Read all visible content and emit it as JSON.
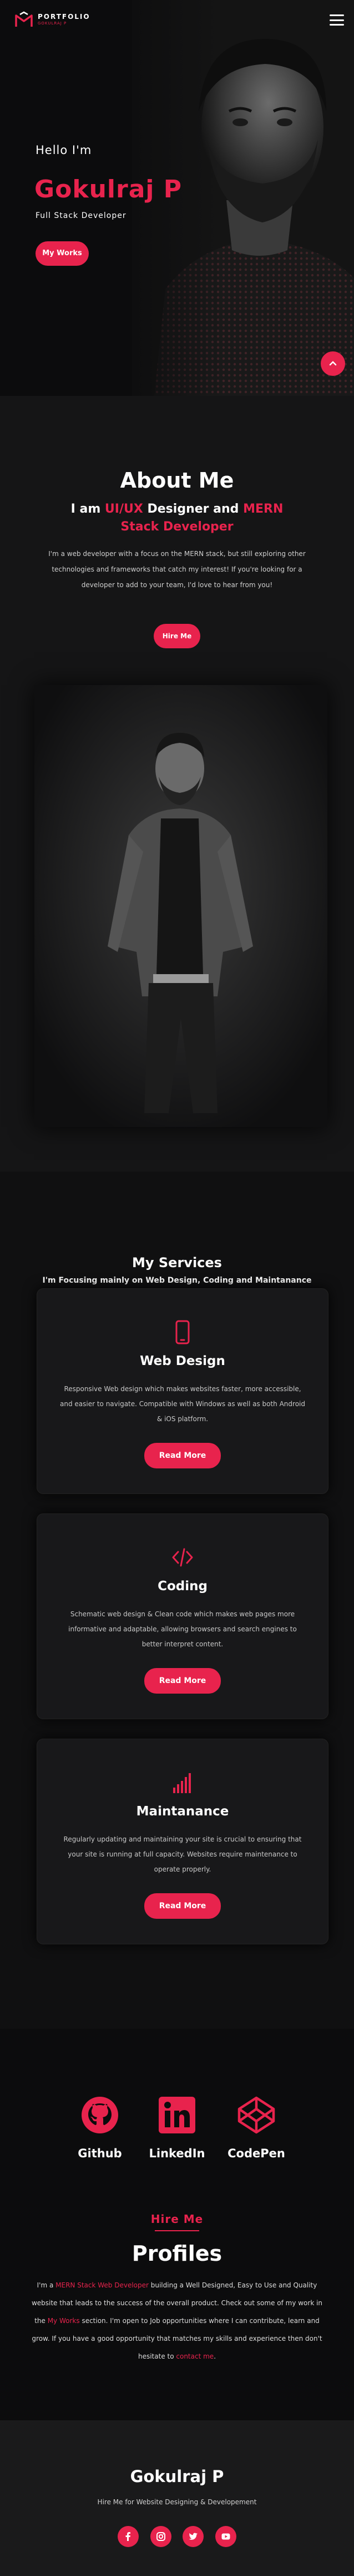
{
  "nav": {
    "logo_title": "PORTFOLIO",
    "logo_subtitle": "GOKULRAJ P"
  },
  "hero": {
    "hello": "Hello   I'm",
    "name": "Gokulraj P",
    "role": "Full   Stack   Developer",
    "button": "My Works"
  },
  "about": {
    "heading": "About Me",
    "sub_prefix": "I am ",
    "sub_accent1": "UI/UX",
    "sub_mid": " Designer and ",
    "sub_accent2": "MERN Stack Developer",
    "text": "I'm a web developer with a focus on the MERN stack, but still exploring other technologies and frameworks that catch my interest! If you're looking for a developer to add to your team, I'd love to hear from you!",
    "button": "Hire Me"
  },
  "services": {
    "heading": "My Services",
    "subheading": "I'm Focusing mainly on Web Design, Coding and Maintanance",
    "cards": [
      {
        "icon": "mobile-icon",
        "title": "Web Design",
        "text": "Responsive Web design which makes websites faster, more accessible, and easier to navigate. Compatible with Windows as well as both Android & iOS platform.",
        "button": "Read More"
      },
      {
        "icon": "code-icon",
        "title": "Coding",
        "text": "Schematic web design & Clean code which makes web pages more informative and adaptable, allowing browsers and search engines to better interpret content.",
        "button": "Read More"
      },
      {
        "icon": "signal-bars-icon",
        "title": "Maintanance",
        "text": "Regularly updating and maintaining your site is crucial to ensuring that your site is running at full capacity. Websites require maintenance to operate properly.",
        "button": "Read More"
      }
    ]
  },
  "profiles": {
    "items": [
      {
        "label": "Github",
        "icon": "github-icon"
      },
      {
        "label": "LinkedIn",
        "icon": "linkedin-icon"
      },
      {
        "label": "CodePen",
        "icon": "codepen-icon"
      }
    ],
    "tag": "Hire Me",
    "heading": "Profiles",
    "text_1": "I'm a ",
    "text_link1": "MERN Stack Web Developer",
    "text_2": " building a Well Designed, Easy to Use and Quality website that leads to the success of the overall product. Check out some of my work in the ",
    "text_link2": "My Works",
    "text_3": " section. I'm open to Job opportunities where I can contribute, learn and grow. If you have a good opportunity that matches my skills and experience then don't hesitate to ",
    "text_link3": "contact me",
    "text_4": "."
  },
  "footer": {
    "name": "Gokulraj P",
    "subtitle": "Hire Me for Website Designing & Developement",
    "socials": [
      "facebook-icon",
      "instagram-icon",
      "twitter-icon",
      "youtube-icon"
    ]
  },
  "colors": {
    "accent": "#e8234d",
    "background": "#0e0e10",
    "card": "#18181a"
  }
}
